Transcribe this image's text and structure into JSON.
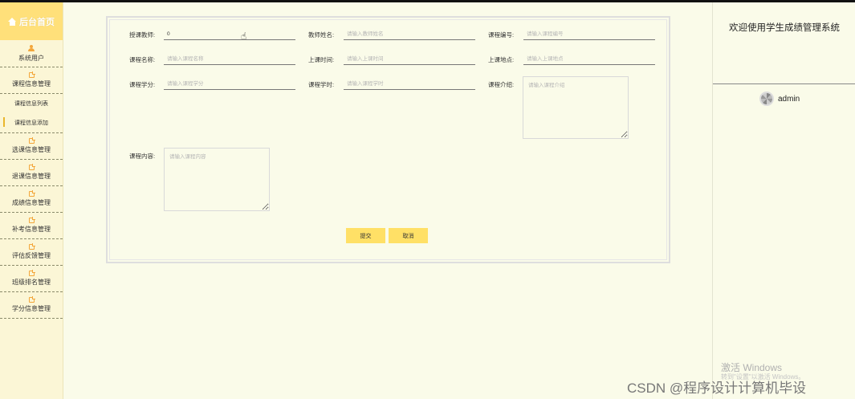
{
  "sidebar": {
    "home_label": "后台首页",
    "user_label": "系统用户",
    "course_group": "课程信息管理",
    "sub_items": [
      "课程信息列表",
      "课程信息添加"
    ],
    "items": [
      "选课信息管理",
      "退课信息管理",
      "成绩信息管理",
      "补考信息管理",
      "评估反馈管理",
      "班级排名管理",
      "学分信息管理"
    ]
  },
  "form": {
    "teacher_account": {
      "label": "授课教师:",
      "value": "0"
    },
    "teacher_name": {
      "label": "教师姓名:",
      "placeholder": "请输入教师姓名"
    },
    "course_code": {
      "label": "课程编号:",
      "placeholder": "请输入课程编号"
    },
    "course_name": {
      "label": "课程名称:",
      "placeholder": "请输入课程名称"
    },
    "class_time": {
      "label": "上课时间:",
      "placeholder": "请输入上课时间"
    },
    "class_location": {
      "label": "上课地点:",
      "placeholder": "请输入上课地点"
    },
    "credits": {
      "label": "课程学分:",
      "placeholder": "请输入课程学分"
    },
    "hours": {
      "label": "课程学时:",
      "placeholder": "请输入课程学时"
    },
    "intro": {
      "label": "课程介绍:",
      "placeholder": "请输入课程介绍"
    },
    "content": {
      "label": "课程内容:",
      "placeholder": "请输入课程内容"
    },
    "submit_label": "提交",
    "cancel_label": "取消"
  },
  "right_panel": {
    "welcome": "欢迎使用学生成绩管理系统",
    "username": "admin"
  },
  "overlay": {
    "activate_title": "激活 Windows",
    "activate_sub": "转到\"设置\"以激活 Windows。",
    "watermark": "CSDN @程序设计计算机毕设"
  },
  "colors": {
    "accent": "#ffe066",
    "background": "#fafbe9",
    "sidebar": "#fbf6d6",
    "icon": "#f3a63a"
  }
}
